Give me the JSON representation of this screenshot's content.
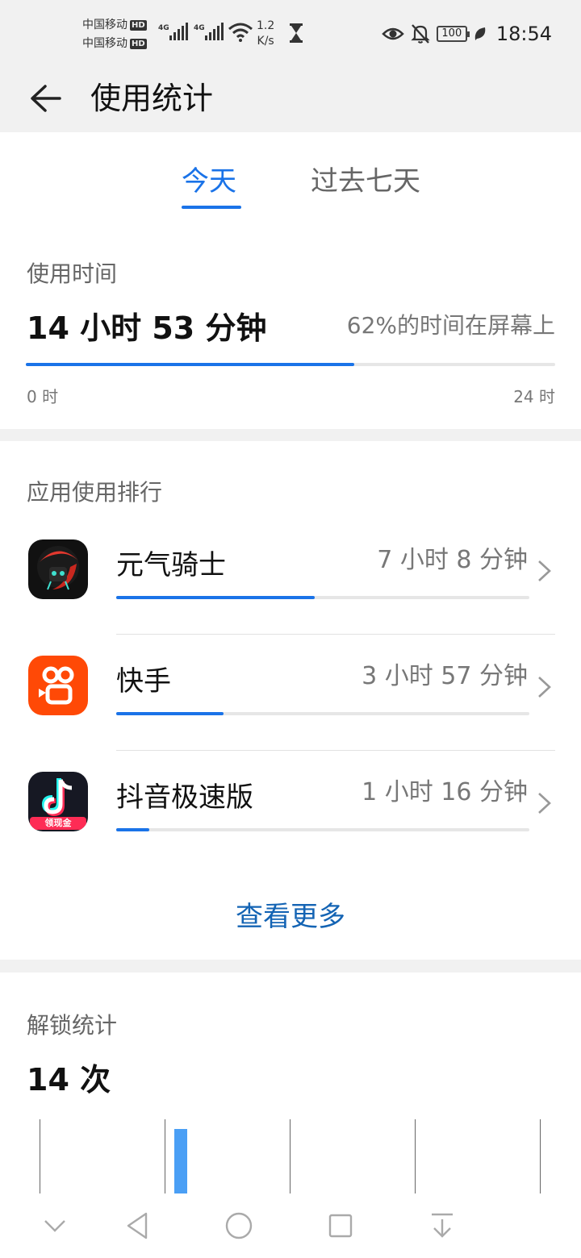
{
  "status_bar": {
    "carrier_1": "中国移动",
    "carrier_2": "中国移动",
    "hd_badge": "HD",
    "network_type": "4G",
    "speed_value": "1.2",
    "speed_unit": "K/s",
    "battery": "100",
    "time": "18:54"
  },
  "header": {
    "title": "使用统计"
  },
  "tabs": [
    {
      "label": "今天",
      "active": true
    },
    {
      "label": "过去七天",
      "active": false
    }
  ],
  "usage": {
    "label": "使用时间",
    "total": "14 小时 53 分钟",
    "screen_pct_note": "62%的时间在屏幕上",
    "progress_fraction": 0.62,
    "axis_start": "0 时",
    "axis_end": "24 时"
  },
  "apps": {
    "label": "应用使用排行",
    "items": [
      {
        "name": "元气骑士",
        "time": "7 小时 8 分钟",
        "bar_fraction": 0.48
      },
      {
        "name": "快手",
        "time": "3 小时 57 分钟",
        "bar_fraction": 0.26
      },
      {
        "name": "抖音极速版",
        "time": "1 小时 16 分钟",
        "bar_fraction": 0.08,
        "icon_badge": "领现金"
      }
    ],
    "view_more": "查看更多"
  },
  "unlock": {
    "label": "解锁统计",
    "count": "14 次"
  },
  "colors": {
    "accent": "#1a73e8",
    "link": "#1464b4",
    "unlock_bar": "#4a9ff5",
    "kuaishou": "#ff4906",
    "background": "#f1f1f1"
  }
}
